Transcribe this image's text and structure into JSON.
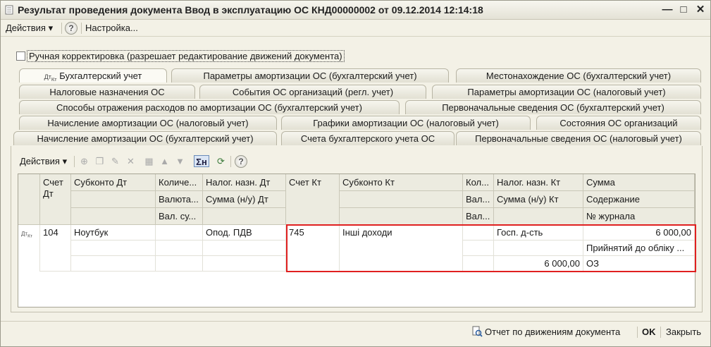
{
  "window": {
    "title": "Результат проведения документа Ввод в эксплуатацию ОС КНД00000002 от 09.12.2014 12:14:18",
    "minimize": "—",
    "maximize": "□",
    "close": "✕"
  },
  "menubar": {
    "actions": "Действия ▾",
    "help": "?",
    "settings": "Настройка..."
  },
  "manual_correction": {
    "checked": false,
    "label": "Ручная корректировка (разрешает редактирование движений документа)"
  },
  "tabs": {
    "row1": [
      "Бухгалтерский учет",
      "Параметры амортизации ОС (бухгалтерский учет)",
      "Местонахождение ОС (бухгалтерский учет)"
    ],
    "row2": [
      "Налоговые назначения ОС",
      "События ОС организаций (регл. учет)",
      "Параметры амортизации ОС (налоговый учет)"
    ],
    "row3": [
      "Способы отражения расходов по амортизации ОС (бухгалтерский учет)",
      "Первоначальные сведения ОС (бухгалтерский учет)"
    ],
    "row4": [
      "Начисление амортизации ОС (налоговый учет)",
      "Графики амортизации ОС (налоговый учет)",
      "Состояния ОС организаций"
    ],
    "row5": [
      "Начисление амортизации ОС (бухгалтерский учет)",
      "Счета бухгалтерского учета ОС",
      "Первоначальные сведения ОС (налоговый учет)"
    ],
    "active": "Бухгалтерский учет"
  },
  "toolbar": {
    "actions": "Действия ▾",
    "help": "?"
  },
  "table": {
    "headers": {
      "schet_dt": "Счет Дт",
      "subkonto_dt": "Субконто Дт",
      "kolich": "Количе...",
      "valyuta": "Валюта...",
      "val_su": "Вал. су...",
      "nalog_dt": "Налог. назн. Дт",
      "summa_nu_dt": "Сумма (н/у) Дт",
      "schet_kt": "Счет Кт",
      "subkonto_kt": "Субконто Кт",
      "kol": "Кол...",
      "val1": "Вал...",
      "val2": "Вал...",
      "nalog_kt": "Налог. назн. Кт",
      "summa_nu_kt": "Сумма (н/у) Кт",
      "summa": "Сумма",
      "soderzhanie": "Содержание",
      "journal": "№ журнала"
    },
    "rows": [
      {
        "schet_dt": "104",
        "subkonto_dt": "Ноутбук",
        "nalog_dt": "Опод. ПДВ",
        "schet_kt": "745",
        "subkonto_kt": "Інші доходи",
        "nalog_kt": "Госп. д-сть",
        "summa": "6 000,00",
        "soderzhanie": "Прийнятий до обліку ...",
        "summa_nu_kt": "6 000,00",
        "journal": "ОЗ"
      }
    ]
  },
  "bottom": {
    "report": "Отчет по движениям документа",
    "ok": "OK",
    "close": "Закрыть"
  }
}
